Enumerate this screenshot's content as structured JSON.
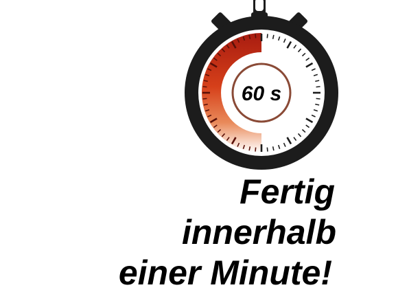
{
  "stopwatch": {
    "display": "60 s",
    "icon": "stopwatch-icon",
    "colors": {
      "body": "#1c1c1c",
      "face": "#ffffff",
      "arc_start": "#a81c10",
      "arc_end": "#ffffff",
      "inner_ring": "#8a4a36",
      "ticks": "#1c1c1c"
    }
  },
  "headline": {
    "line1": "Fertig",
    "line2": "innerhalb",
    "line3": "einer Minute!"
  }
}
